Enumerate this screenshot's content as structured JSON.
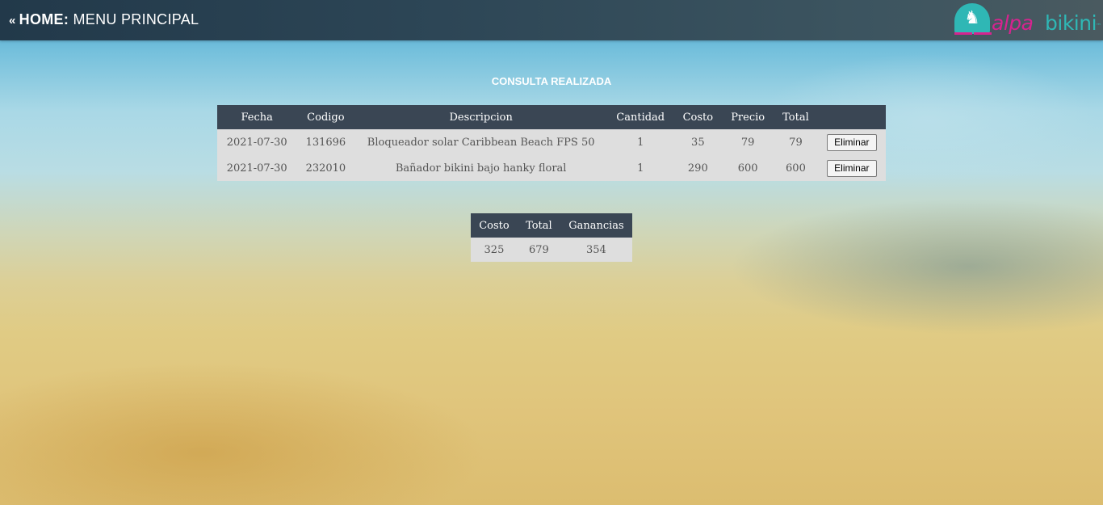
{
  "header": {
    "arrow": "«",
    "home_label": "HOME:",
    "menu_label": "MENU PRINCIPAL",
    "logo": {
      "alpa": "alpa",
      "bikini": "bikini",
      "tm": "™",
      "colors": {
        "pink": "#d6248f",
        "teal": "#2fb7b5"
      }
    }
  },
  "page_title": "CONSULTA REALIZADA",
  "detail_table": {
    "headers": {
      "fecha": "Fecha",
      "codigo": "Codigo",
      "descripcion": "Descripcion",
      "cantidad": "Cantidad",
      "costo": "Costo",
      "precio": "Precio",
      "total": "Total",
      "action": ""
    },
    "rows": [
      {
        "fecha": "2021-07-30",
        "codigo": "131696",
        "descripcion": "Bloqueador solar Caribbean Beach FPS 50",
        "cantidad": "1",
        "costo": "35",
        "precio": "79",
        "total": "79",
        "action": "Eliminar"
      },
      {
        "fecha": "2021-07-30",
        "codigo": "232010",
        "descripcion": "Bañador bikini bajo hanky floral",
        "cantidad": "1",
        "costo": "290",
        "precio": "600",
        "total": "600",
        "action": "Eliminar"
      }
    ]
  },
  "summary_table": {
    "headers": {
      "costo": "Costo",
      "total": "Total",
      "ganancias": "Ganancias"
    },
    "values": {
      "costo": "325",
      "total": "679",
      "ganancias": "354"
    }
  },
  "colors": {
    "header_bar": "#2d4656",
    "table_header": "#3a4654",
    "table_row": "#dedede"
  }
}
